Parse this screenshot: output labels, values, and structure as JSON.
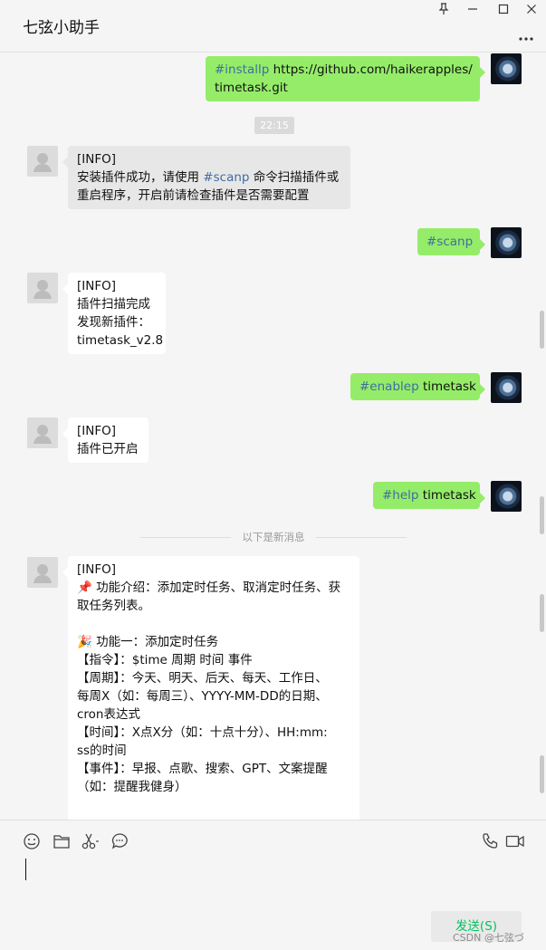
{
  "window": {
    "title": "七弦小助手",
    "controls": [
      "pin-icon",
      "minimize-icon",
      "maximize-icon",
      "close-icon"
    ],
    "more_icon": "more-dots-icon"
  },
  "chat": {
    "time_separator": "22:15",
    "new_messages_divider": "以下是新消息",
    "messages": [
      {
        "sender": "me",
        "lines": [
          [
            {
              "text": "#installp ",
              "tag": true
            },
            {
              "text": "https://github.com/haikerapples/"
            }
          ],
          [
            {
              "text": "timetask.git",
              "tag": false
            }
          ]
        ]
      },
      {
        "sender": "bot",
        "lines": [
          [
            {
              "text": "[INFO]"
            }
          ],
          [
            {
              "text": "安装插件成功，请使用 "
            },
            {
              "text": "#scanp",
              "tag": true
            },
            {
              "text": " 命令扫描插件或"
            }
          ],
          [
            {
              "text": "重启程序，开启前请检查插件是否需要配置"
            }
          ]
        ]
      },
      {
        "sender": "me",
        "lines": [
          [
            {
              "text": "#scanp",
              "tag": true
            }
          ]
        ]
      },
      {
        "sender": "bot",
        "lines": [
          [
            {
              "text": "[INFO]"
            }
          ],
          [
            {
              "text": "插件扫描完成"
            }
          ],
          [
            {
              "text": "发现新插件："
            }
          ],
          [
            {
              "text": "timetask_v2.8"
            }
          ]
        ]
      },
      {
        "sender": "me",
        "lines": [
          [
            {
              "text": "#enablep",
              "tag": true
            },
            {
              "text": " timetask"
            }
          ]
        ]
      },
      {
        "sender": "bot",
        "lines": [
          [
            {
              "text": "[INFO]"
            }
          ],
          [
            {
              "text": "插件已开启"
            }
          ]
        ]
      },
      {
        "sender": "me",
        "lines": [
          [
            {
              "text": "#help",
              "tag": true
            },
            {
              "text": " timetask"
            }
          ]
        ]
      },
      {
        "sender": "bot",
        "lines": [
          [
            {
              "text": "[INFO]"
            }
          ],
          [
            {
              "text": "📌 功能介绍：添加定时任务、取消定时任务、获"
            }
          ],
          [
            {
              "text": "取任务列表。"
            }
          ],
          [
            {
              "text": " "
            }
          ],
          [
            {
              "text": "🎉 功能一：添加定时任务"
            }
          ],
          [
            {
              "text": "【指令】：$time 周期 时间 事件"
            }
          ],
          [
            {
              "text": "【周期】：今天、明天、后天、每天、工作日、"
            }
          ],
          [
            {
              "text": "每周X（如：每周三）、YYYY-MM-DD的日期、"
            }
          ],
          [
            {
              "text": "cron表达式"
            }
          ],
          [
            {
              "text": "【时间】：X点X分（如：十点十分）、HH:mm:"
            }
          ],
          [
            {
              "text": "ss的时间"
            }
          ],
          [
            {
              "text": "【事件】：早报、点歌、搜索、GPT、文案提醒"
            }
          ],
          [
            {
              "text": "（如：提醒我健身）"
            }
          ]
        ]
      }
    ]
  },
  "input": {
    "tools": [
      "emoji-icon",
      "folder-icon",
      "scissors-icon",
      "chat-bubble-icon"
    ],
    "call_tools": [
      "phone-icon",
      "video-icon"
    ],
    "send_label": "发送(S)",
    "watermark": "CSDN @七弦づ"
  }
}
